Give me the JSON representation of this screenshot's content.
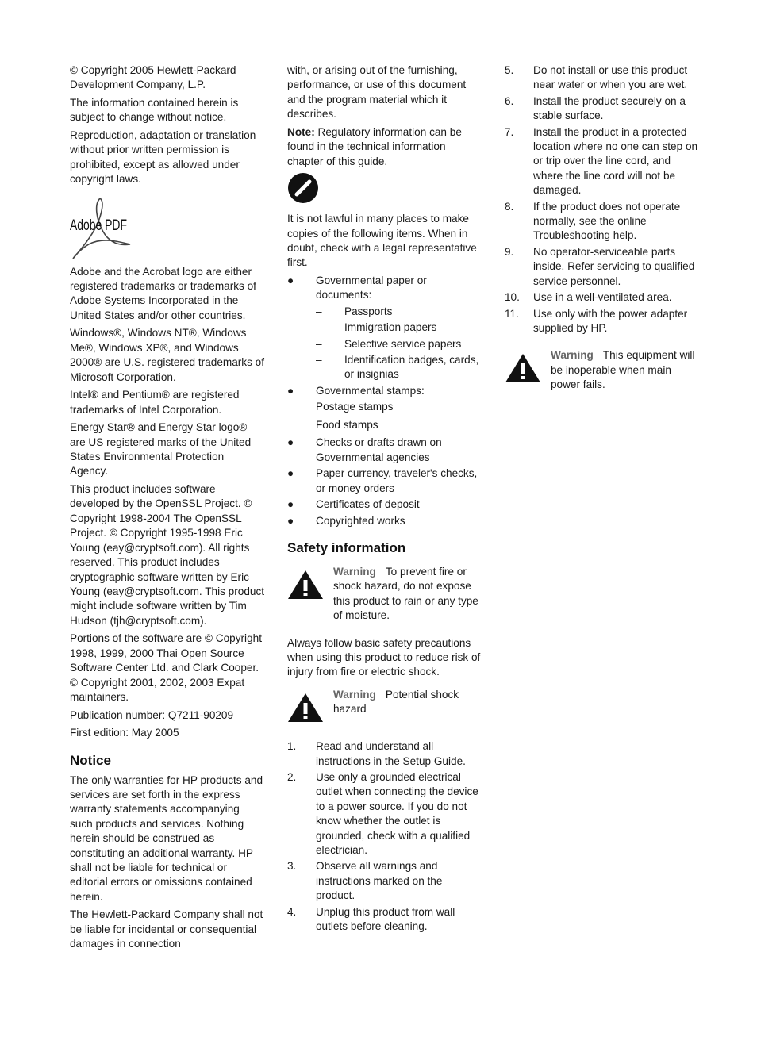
{
  "column1": {
    "paragraphs_top": [
      "© Copyright 2005 Hewlett-Packard Development Company, L.P.",
      "The information contained herein is subject to change without notice.",
      "Reproduction, adaptation or translation without prior written permission is prohibited, except as allowed under copyright laws."
    ],
    "logo": {
      "text": "Adobe PDF",
      "icon": "adobe-acrobat-logo"
    },
    "paragraphs_mid": [
      "Adobe and the Acrobat logo are either registered trademarks or trademarks of Adobe Systems Incorporated in the United States and/or other countries.",
      "Windows®, Windows NT®, Windows Me®, Windows XP®, and Windows 2000® are U.S. registered trademarks of Microsoft Corporation.",
      "Intel® and Pentium® are registered trademarks of Intel Corporation.",
      "Energy Star® and Energy Star logo® are US registered marks of the United States Environmental Protection Agency.",
      "This product includes software developed by the OpenSSL Project. © Copyright 1998-2004 The OpenSSL Project. © Copyright 1995-1998 Eric Young (eay@cryptsoft.com). All rights reserved. This product includes cryptographic software written by Eric Young (eay@cryptsoft.com. This product might include software written by Tim Hudson (tjh@cryptsoft.com).",
      "Portions of the software are © Copyright 1998, 1999, 2000 Thai Open Source Software Center Ltd. and Clark Cooper. © Copyright 2001, 2002, 2003 Expat maintainers.",
      "Publication number: Q7211-90209",
      "First edition: May 2005"
    ],
    "notice_heading": "Notice",
    "notice_paragraphs": [
      "The only warranties for HP products and services are set forth in the express warranty statements accompanying such products and services. Nothing herein should be construed as constituting an additional warranty. HP shall not be liable for technical or editorial errors or omissions contained herein.",
      "The Hewlett-Packard Company shall not be liable for incidental or consequential damages in connection"
    ]
  },
  "column2": {
    "continuation": "with, or arising out of the furnishing, performance, or use of this document and the program material which it describes.",
    "note_label": "Note:",
    "note_text": " Regulatory information can be found in the technical information chapter of this guide.",
    "prohibit_icon": "prohibited-icon",
    "intro": "It is not lawful in many places to make copies of the following items. When in doubt, check with a legal representative first.",
    "bullet_marker": "●",
    "dash_marker": "–",
    "item_gov_papers": "Governmental paper or documents:",
    "sub_items": [
      "Passports",
      "Immigration papers",
      "Selective service papers",
      "Identification badges, cards, or insignias"
    ],
    "item_gov_stamps": "Governmental stamps:",
    "stamp_items": [
      "Postage stamps",
      "Food stamps"
    ],
    "items_rest": [
      "Checks or drafts drawn on Governmental agencies",
      "Paper currency, traveler's checks, or money orders",
      "Certificates of deposit",
      "Copyrighted works"
    ],
    "safety_heading": "Safety information",
    "warning1": {
      "label": "Warning",
      "text": "To prevent fire or shock hazard, do not expose this product to rain or any type of moisture."
    },
    "safety_intro": "Always follow basic safety precautions when using this product to reduce risk of injury from fire or electric shock.",
    "warning2": {
      "label": "Warning",
      "text": "Potential shock hazard"
    },
    "steps": [
      {
        "num": "1.",
        "text": "Read and understand all instructions in the Setup Guide."
      },
      {
        "num": "2.",
        "text": "Use only a grounded electrical outlet when connecting the device to a power source. If you do not know whether the outlet is grounded, check with a qualified electrician."
      },
      {
        "num": "3.",
        "text": "Observe all warnings and instructions marked on the product."
      },
      {
        "num": "4.",
        "text": "Unplug this product from wall outlets before cleaning."
      }
    ]
  },
  "column3": {
    "steps": [
      {
        "num": "5.",
        "text": "Do not install or use this product near water or when you are wet."
      },
      {
        "num": "6.",
        "text": "Install the product securely on a stable surface."
      },
      {
        "num": "7.",
        "text": "Install the product in a protected location where no one can step on or trip over the line cord, and where the line cord will not be damaged."
      },
      {
        "num": "8.",
        "text": "If the product does not operate normally, see the online Troubleshooting help."
      },
      {
        "num": "9.",
        "text": "No operator-serviceable parts inside. Refer servicing to qualified service personnel."
      },
      {
        "num": "10.",
        "text": "Use in a well-ventilated area."
      },
      {
        "num": "11.",
        "text": "Use only with the power adapter supplied by HP."
      }
    ],
    "warning3": {
      "label": "Warning",
      "text": "This equipment will be inoperable when main power fails."
    }
  },
  "colors": {
    "text": "#1a1a1a",
    "warning_label": "#666666",
    "icon": "#111111"
  }
}
